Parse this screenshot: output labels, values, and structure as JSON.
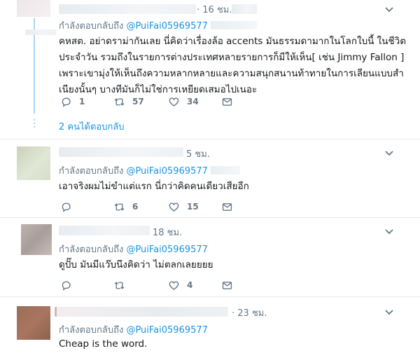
{
  "tweets": [
    {
      "time": "· 16 ชม.",
      "reply_prefix": "กำลังตอบกลับถึง",
      "reply_handle": "@PuiFai05969577",
      "text": "คหสต. อย่าดราม่ากันเลย นี่คิดว่าเรื่องล้อ accents มันธรรมดามากในโลกใบนี้ ในชีวิต\nประจำวัน รวมถึงในรายการต่างประเทศหลายรายการก็มีให้เห็น[ เช่น Jimmy Fallon ]\nเพราะเขามุ่งให้เห็นถึงความหลากหลายและความสนุกสนานท้าทายในการเลียนแบบสำ\nเนียงนั้นๆ บางทีมันก็ไม่ใช่การเหยียดเสมอไปเนอะ",
      "counts": {
        "reply": "1",
        "retweet": "57",
        "like": "34"
      },
      "more_replies": "2 คนได้ตอบกลับ"
    },
    {
      "time": "5 ชม.",
      "reply_prefix": "กำลังตอบกลับถึง",
      "reply_handle": "@PuiFai05969577",
      "text": "เอาจริงผมไม่ขำแต่แรก นี่กว่าคิดคนเดียวเสียอีก",
      "counts": {
        "reply": "",
        "retweet": "6",
        "like": "15"
      }
    },
    {
      "time": "18 ชม.",
      "reply_prefix": "กำลังตอบกลับถึง",
      "reply_handle": "@PuiFai05969577",
      "text": "ดูปั๊บ มันมีแว๊บนึงคิดว่า ไม่ตลกเลยยยย",
      "counts": {
        "reply": "",
        "retweet": "",
        "like": "4"
      }
    },
    {
      "time": "· 23 ชม.",
      "reply_prefix": "กำลังตอบกลับถึง",
      "reply_handle": "@PuiFai05969577",
      "text": "Cheap is the word.",
      "counts": {}
    }
  ],
  "colors": {
    "link": "#1b95e0",
    "muted": "#657786",
    "thread_line": "#a8d6f7",
    "divider": "#e6ecf0"
  },
  "icons": [
    "reply-icon",
    "retweet-icon",
    "like-icon",
    "dm-icon",
    "chevron-down-icon"
  ]
}
